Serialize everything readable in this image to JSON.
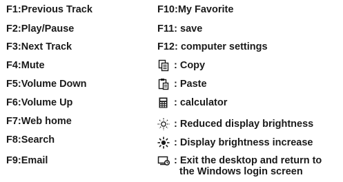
{
  "left_column": [
    "F1:Previous Track",
    "F2:Play/Pause",
    "F3:Next Track",
    "F4:Mute",
    "F5:Volume Down",
    "F6:Volume Up",
    "F7:Web home",
    "F8:Search",
    "F9:Email"
  ],
  "right_column": [
    {
      "text": "F10:My Favorite",
      "icon": ""
    },
    {
      "text": "F11: save",
      "icon": ""
    },
    {
      "text": "F12: computer settings",
      "icon": ""
    },
    {
      "text": ": Copy",
      "icon": "copy-icon"
    },
    {
      "text": ": Paste",
      "icon": "paste-icon"
    },
    {
      "text": ": calculator",
      "icon": "calculator-icon"
    },
    {
      "text": ": Reduced display brightness",
      "icon": "brightness-down-icon"
    },
    {
      "text": ": Display brightness increase",
      "icon": "brightness-up-icon"
    },
    {
      "text_line1": ": Exit the desktop and return to",
      "text_line2": "the Windows login screen",
      "icon": "lock-screen-icon"
    }
  ]
}
